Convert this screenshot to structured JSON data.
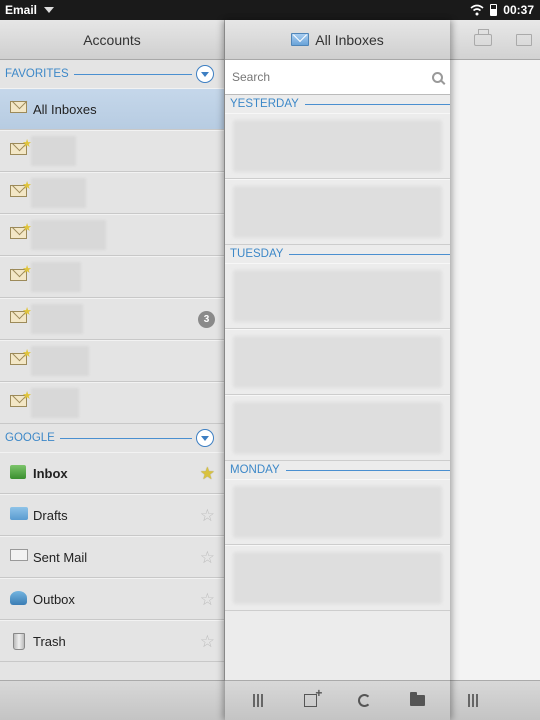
{
  "status_bar": {
    "app_name": "Email",
    "time": "00:37"
  },
  "accounts_pane": {
    "title": "Accounts",
    "favorites_header": "FAVORITES",
    "all_inboxes_label": "All Inboxes",
    "favorite_badge_count": "3",
    "google_header": "GOOGLE",
    "folders": [
      {
        "label": "Inbox",
        "icon": "inbox-icon",
        "starred": true
      },
      {
        "label": "Drafts",
        "icon": "drafts-folder-icon",
        "starred": false
      },
      {
        "label": "Sent Mail",
        "icon": "sent-mail-icon",
        "starred": false
      },
      {
        "label": "Outbox",
        "icon": "outbox-icon",
        "starred": false
      },
      {
        "label": "Trash",
        "icon": "trash-icon",
        "starred": false
      }
    ]
  },
  "message_pane": {
    "title": "All Inboxes",
    "search_placeholder": "Search",
    "sections": [
      "YESTERDAY",
      "TUESDAY",
      "MONDAY"
    ]
  },
  "colors": {
    "accent": "#3d88c8",
    "selected_row": "#c5d7ea",
    "star_on": "#d9c23e"
  }
}
